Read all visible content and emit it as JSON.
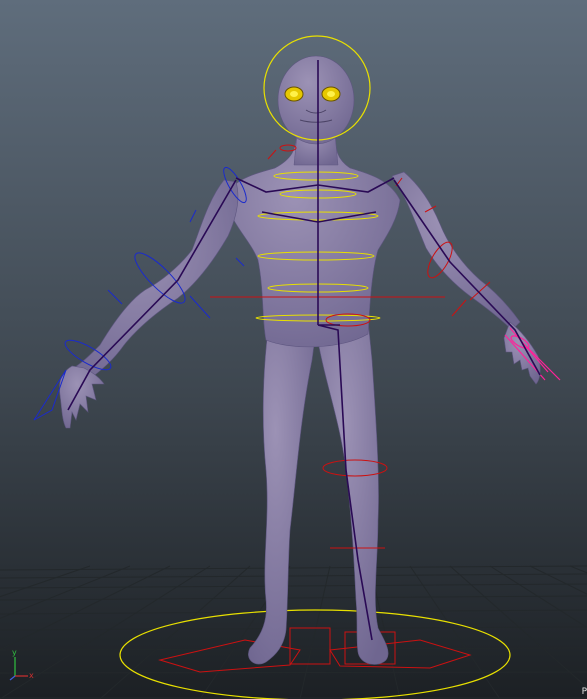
{
  "viewport": {
    "background_top": "#5d6c7c",
    "background_bottom": "#1d2226",
    "grid_color": "#222628",
    "camera_label": "P"
  },
  "character": {
    "skin_color": "#8a7fa3",
    "eye_color": "#e6c800",
    "skeleton_color": "#2a0a55"
  },
  "controls": {
    "ik_color": "#cc1111",
    "fk_left_color": "#1a2acc",
    "spine_color": "#e8e000",
    "hand_right_color": "#ff2299"
  },
  "axis_gizmo": {
    "x_label": "x",
    "y_label": "y",
    "x_color": "#d03030",
    "y_color": "#30c040",
    "z_color": "#4060e0"
  }
}
